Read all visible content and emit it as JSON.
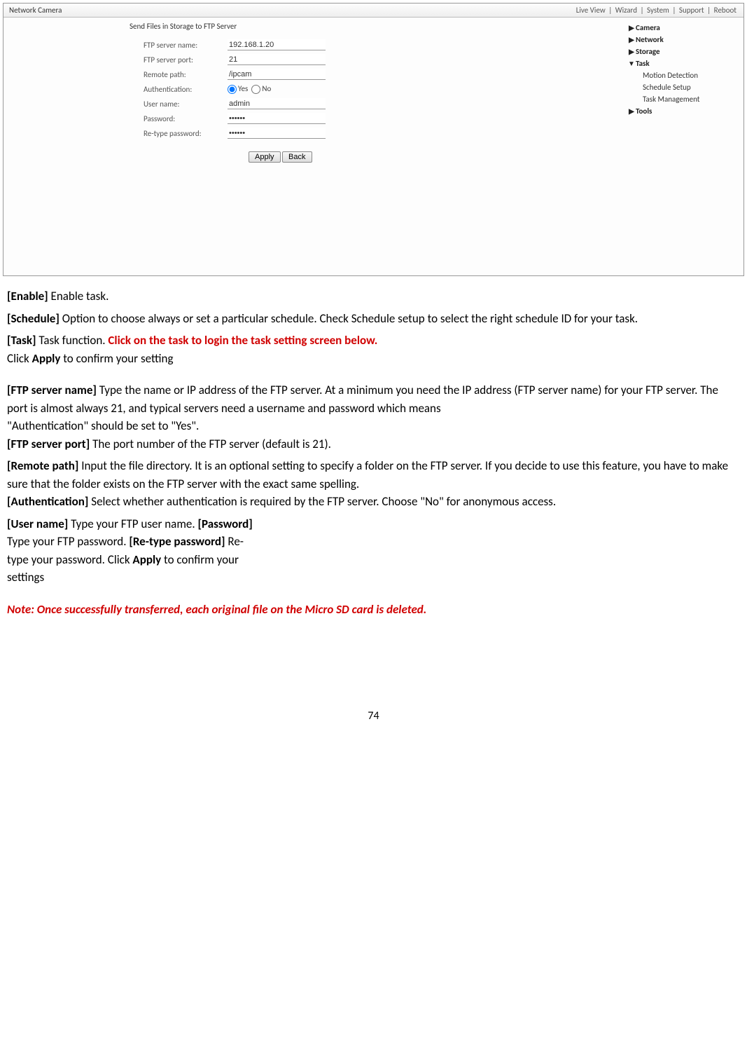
{
  "screenshot": {
    "app_title": "Network Camera",
    "topnav": [
      "Live View",
      "Wizard",
      "System",
      "Support",
      "Reboot"
    ],
    "section_title": "Send Files in Storage to FTP Server",
    "form": {
      "server_name": {
        "label": "FTP server name:",
        "value": "192.168.1.20"
      },
      "server_port": {
        "label": "FTP server port:",
        "value": "21"
      },
      "remote_path": {
        "label": "Remote path:",
        "value": "/ipcam"
      },
      "auth": {
        "label": "Authentication:",
        "yes": "Yes",
        "no": "No"
      },
      "user": {
        "label": "User name:",
        "value": "admin"
      },
      "password": {
        "label": "Password:",
        "value": "••••••"
      },
      "retype": {
        "label": "Re-type password:",
        "value": "••••••"
      }
    },
    "buttons": {
      "apply": "Apply",
      "back": "Back"
    },
    "side": {
      "camera": "Camera",
      "network": "Network",
      "storage": "Storage",
      "task": "Task",
      "task_sub": [
        "Motion Detection",
        "Schedule Setup",
        "Task Management"
      ],
      "tools": "Tools"
    }
  },
  "doc": {
    "p1a": "[Enable] ",
    "p1b": "Enable task.",
    "p2a": "[Schedule] ",
    "p2b": "Option to choose always or set a particular schedule. Check Schedule setup to select the right schedule ID for your task.",
    "p3a": "[Task] ",
    "p3b": "Task function. ",
    "p3c": "Click on the task to login the task setting screen below.",
    "p4a": "Click ",
    "p4b": "Apply ",
    "p4c": "to confirm your setting",
    "p5a": "[FTP server name] ",
    "p5b": "Type the name or IP address of the FTP server. ",
    "p5c": "At a minimum you need the IP address (FTP server name) for your FTP server. The port is almost always 21, and typical servers need a username and password which means",
    "p5d": "\"Authentication\" should be set to \"Yes\".",
    "p6a": "[FTP server port] ",
    "p6b": "The port number of the FTP server (default is 21).",
    "p7a": "[Remote path] ",
    "p7b": "Input the file directory. ",
    "p7c": "It is an optional setting to specify a folder on the FTP server. If you decide to use this feature, you have to make sure that the folder exists on the FTP server with the exact same spelling.",
    "p8a": "[Authentication] ",
    "p8b": "Select whether authentication is required by the FTP server. Choose \"No\" for anonymous access.",
    "p9a": "[User name] ",
    "p9b": "Type your FTP user name. ",
    "p9c": "[Password] ",
    "p9d": "Type your FTP password. ",
    "p9e": "[Re-type password] ",
    "p9f": "Re-type your password. Click ",
    "p9g": "Apply ",
    "p9h": "to confirm your settings",
    "note": "Note: Once successfully transferred, each original file on the Micro SD card is deleted."
  },
  "page_number": "74"
}
